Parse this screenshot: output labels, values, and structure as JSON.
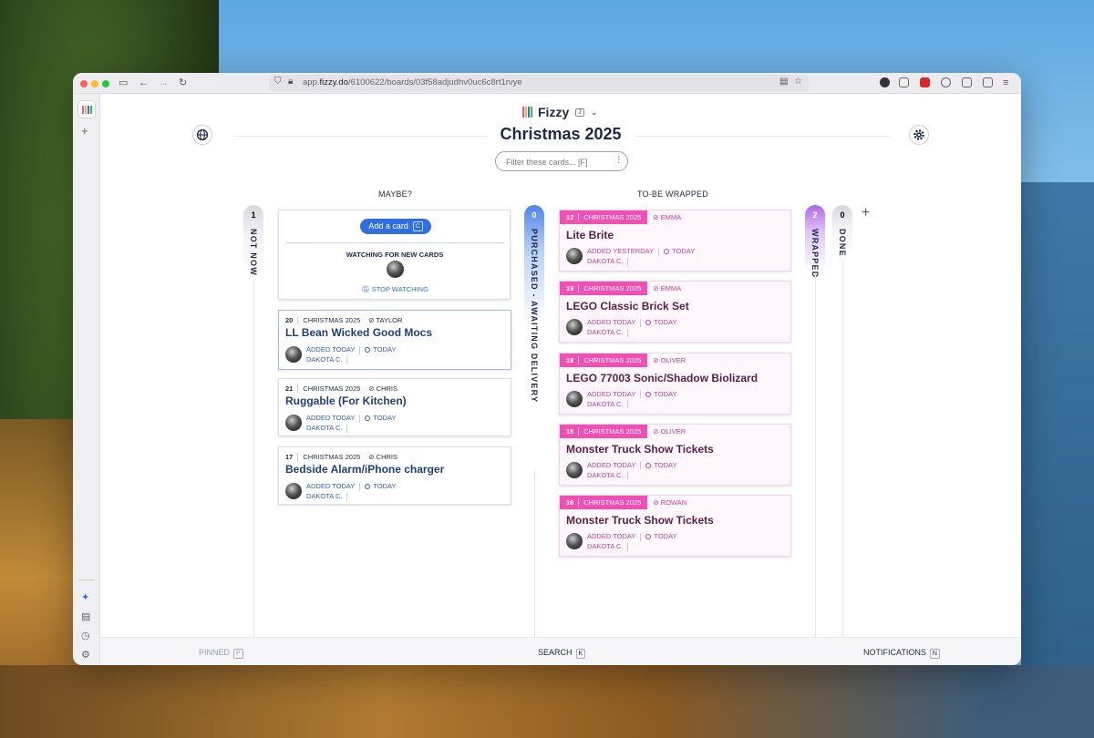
{
  "browser": {
    "url_prefix": "app.",
    "url_domain": "fizzy.do",
    "url_path": "/6100622/boards/03f58adjudhv0uc6c8rt1rvye"
  },
  "app": {
    "name": "Fizzy",
    "shortcut": "J"
  },
  "board": {
    "title": "Christmas 2025",
    "filter_placeholder": "Filter these cards... [F]"
  },
  "columns": {
    "not_now": {
      "label": "NOT NOW",
      "count": "1"
    },
    "maybe": {
      "label": "MAYBE?",
      "add_card": "Add a card",
      "add_card_key": "C",
      "watching": "WATCHING FOR NEW CARDS",
      "stop_watching": "STOP WATCHING"
    },
    "purchased": {
      "label": "PURCHASED - AWAITING DELIVERY",
      "count": "0"
    },
    "to_be_wrapped": {
      "label": "TO-BE WRAPPED"
    },
    "wrapped": {
      "label": "WRAPPED",
      "count": "2"
    },
    "done": {
      "label": "DONE",
      "count": "0"
    }
  },
  "maybe_cards": [
    {
      "num": "20",
      "board": "CHRISTMAS 2025",
      "tag": "TAYLOR",
      "title": "LL Bean Wicked Good Mocs",
      "added": "ADDED TODAY",
      "updated": "TODAY",
      "author": "DAKOTA C."
    },
    {
      "num": "21",
      "board": "CHRISTMAS 2025",
      "tag": "CHRIS",
      "title": "Ruggable (For Kitchen)",
      "added": "ADDED TODAY",
      "updated": "TODAY",
      "author": "DAKOTA C."
    },
    {
      "num": "17",
      "board": "CHRISTMAS 2025",
      "tag": "CHRIS",
      "title": "Bedside Alarm/iPhone charger",
      "added": "ADDED TODAY",
      "updated": "TODAY",
      "author": "DAKOTA C."
    }
  ],
  "wrap_cards": [
    {
      "num": "12",
      "board": "CHRISTMAS 2025",
      "tag": "EMMA",
      "title": "Lite Brite",
      "added": "ADDED YESTERDAY",
      "updated": "TODAY",
      "author": "DAKOTA C."
    },
    {
      "num": "19",
      "board": "CHRISTMAS 2025",
      "tag": "EMMA",
      "title": "LEGO Classic Brick Set",
      "added": "ADDED TODAY",
      "updated": "TODAY",
      "author": "DAKOTA C."
    },
    {
      "num": "18",
      "board": "CHRISTMAS 2025",
      "tag": "OLIVER",
      "title": "LEGO 77003 Sonic/Shadow Biolizard",
      "added": "ADDED TODAY",
      "updated": "TODAY",
      "author": "DAKOTA C."
    },
    {
      "num": "15",
      "board": "CHRISTMAS 2025",
      "tag": "OLIVER",
      "title": "Monster Truck Show Tickets",
      "added": "ADDED TODAY",
      "updated": "TODAY",
      "author": "DAKOTA C."
    },
    {
      "num": "16",
      "board": "CHRISTMAS 2025",
      "tag": "ROWAN",
      "title": "Monster Truck Show Tickets",
      "added": "ADDED TODAY",
      "updated": "TODAY",
      "author": "DAKOTA C."
    }
  ],
  "footer": {
    "pinned": "PINNED",
    "pinned_key": "P",
    "search": "SEARCH",
    "search_key": "K",
    "notifications": "NOTIFICATIONS",
    "notifications_key": "N"
  },
  "colors": {
    "accent_blue": "#2f6fe0",
    "wrap_pink": "#f04fb4",
    "title_navy": "#1f2847"
  },
  "icons": [
    "globe-icon",
    "gear-icon",
    "tag-icon",
    "filter-sliders-icon",
    "bell-off-icon",
    "plus-icon",
    "sparkle-icon",
    "clock-icon",
    "chevron-down-icon"
  ]
}
